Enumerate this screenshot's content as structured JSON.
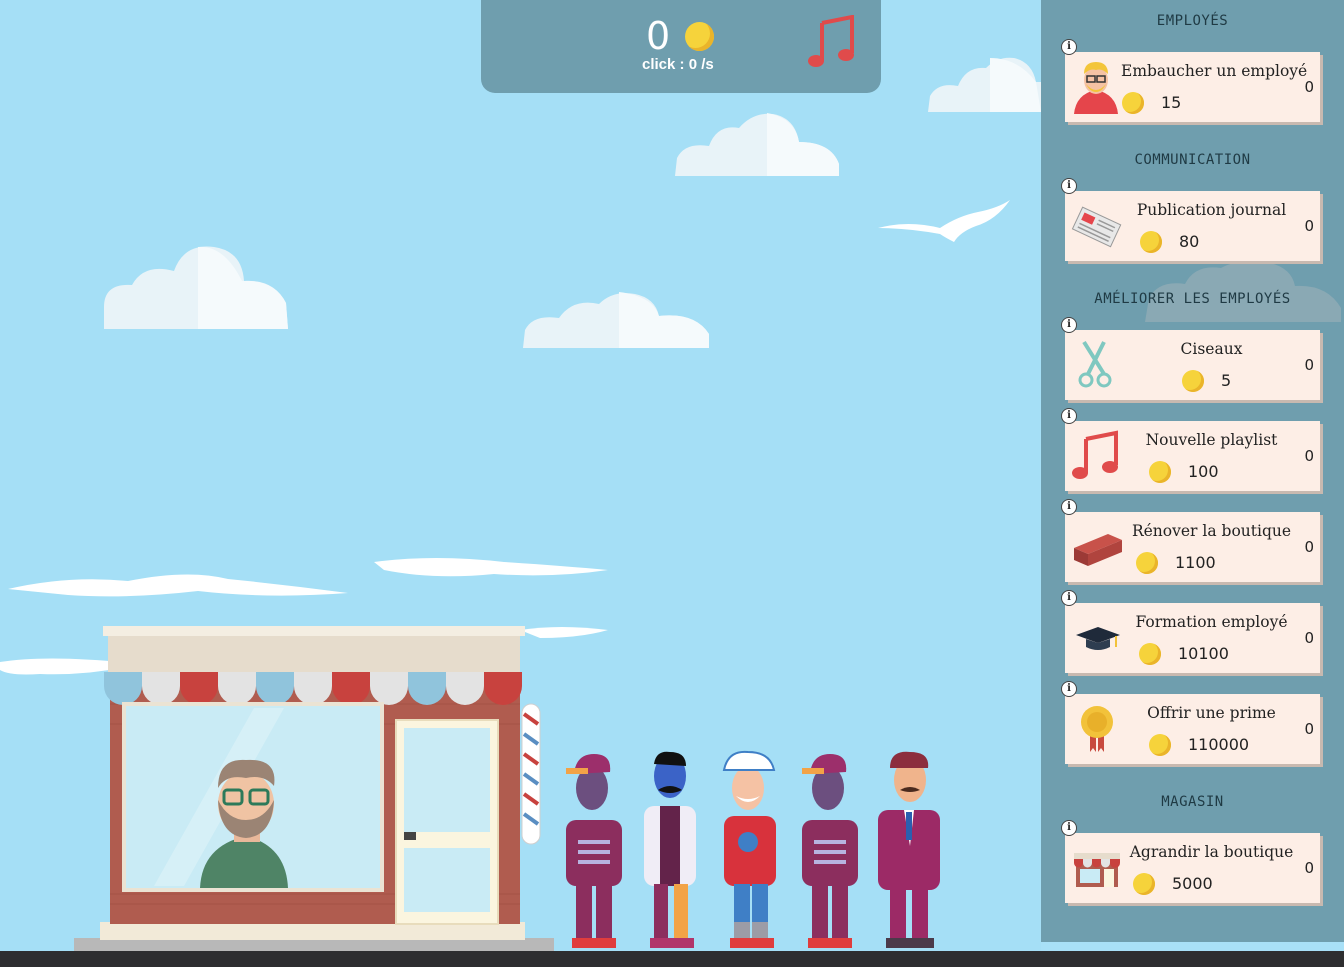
{
  "hud": {
    "score": "0",
    "rate": "click : 0 /s",
    "music_icon": "music-note-icon"
  },
  "sections": {
    "employees": "EMPLOYÉS",
    "communication": "COMMUNICATION",
    "upgrades": "AMÉLIORER LES EMPLOYÉS",
    "store": "MAGASIN"
  },
  "items": [
    {
      "label": "Embaucher un employé",
      "price": "15",
      "count": "0",
      "icon": "hire-employee-icon"
    },
    {
      "label": "Publication journal",
      "price": "80",
      "count": "0",
      "icon": "newspaper-icon"
    },
    {
      "label": "Ciseaux",
      "price": "5",
      "count": "0",
      "icon": "scissors-icon"
    },
    {
      "label": "Nouvelle playlist",
      "price": "100",
      "count": "0",
      "icon": "music-note-icon"
    },
    {
      "label": "Rénover la boutique",
      "price": "1100",
      "count": "0",
      "icon": "brick-icon"
    },
    {
      "label": "Formation employé",
      "price": "10100",
      "count": "0",
      "icon": "graduation-cap-icon"
    },
    {
      "label": "Offrir une prime",
      "price": "110000",
      "count": "0",
      "icon": "medal-icon"
    },
    {
      "label": "Agrandir la boutique",
      "price": "5000",
      "count": "0",
      "icon": "shop-icon"
    }
  ],
  "info_glyph": "i",
  "colors": {
    "sky": "#a5dff6",
    "panel": "#6f9eae",
    "card": "#fdeee6",
    "coin": "#f6d33b",
    "music": "#e04b4b"
  }
}
